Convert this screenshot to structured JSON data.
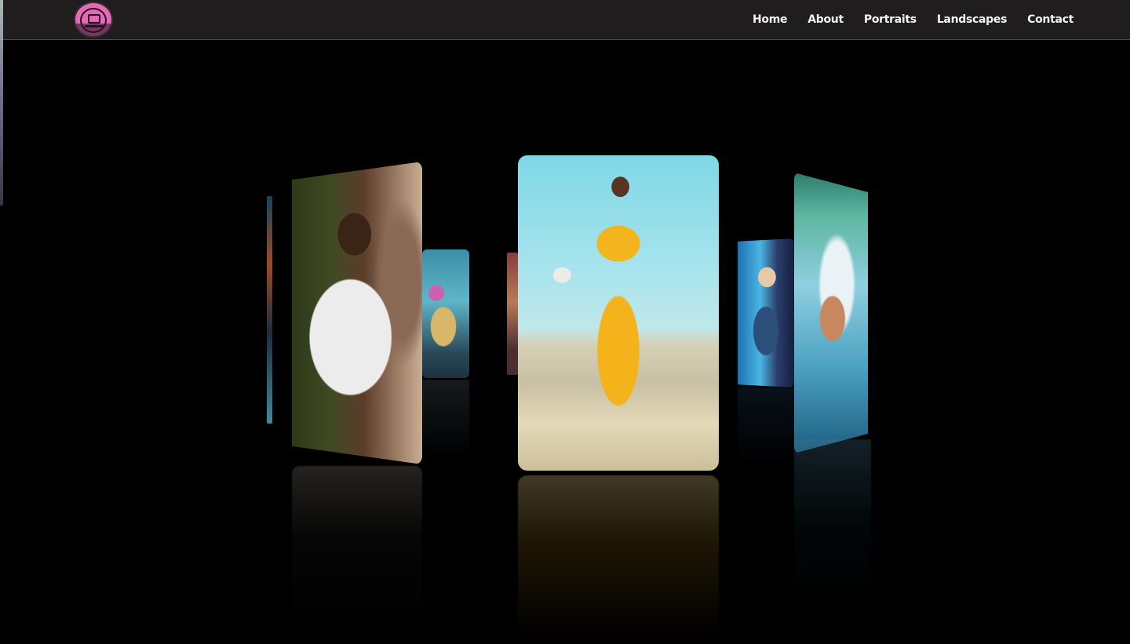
{
  "header": {
    "logo_icon": "camera-badge-icon",
    "nav": [
      {
        "label": "Home"
      },
      {
        "label": "About"
      },
      {
        "label": "Portraits"
      },
      {
        "label": "Landscapes"
      },
      {
        "label": "Contact"
      }
    ]
  },
  "gallery": {
    "cards": [
      {
        "name": "portrait-man-white-shirt"
      },
      {
        "name": "portrait-woman-sunglasses"
      },
      {
        "name": "portrait-woman-yellow-tracksuit"
      },
      {
        "name": "portrait-woman-blonde-neon"
      },
      {
        "name": "portrait-woman-water"
      }
    ]
  },
  "colors": {
    "navbar_bg": "#1f1d1d",
    "logo_accent": "#e46ab8",
    "page_bg": "#000000",
    "nav_text": "#f3f3f3"
  }
}
